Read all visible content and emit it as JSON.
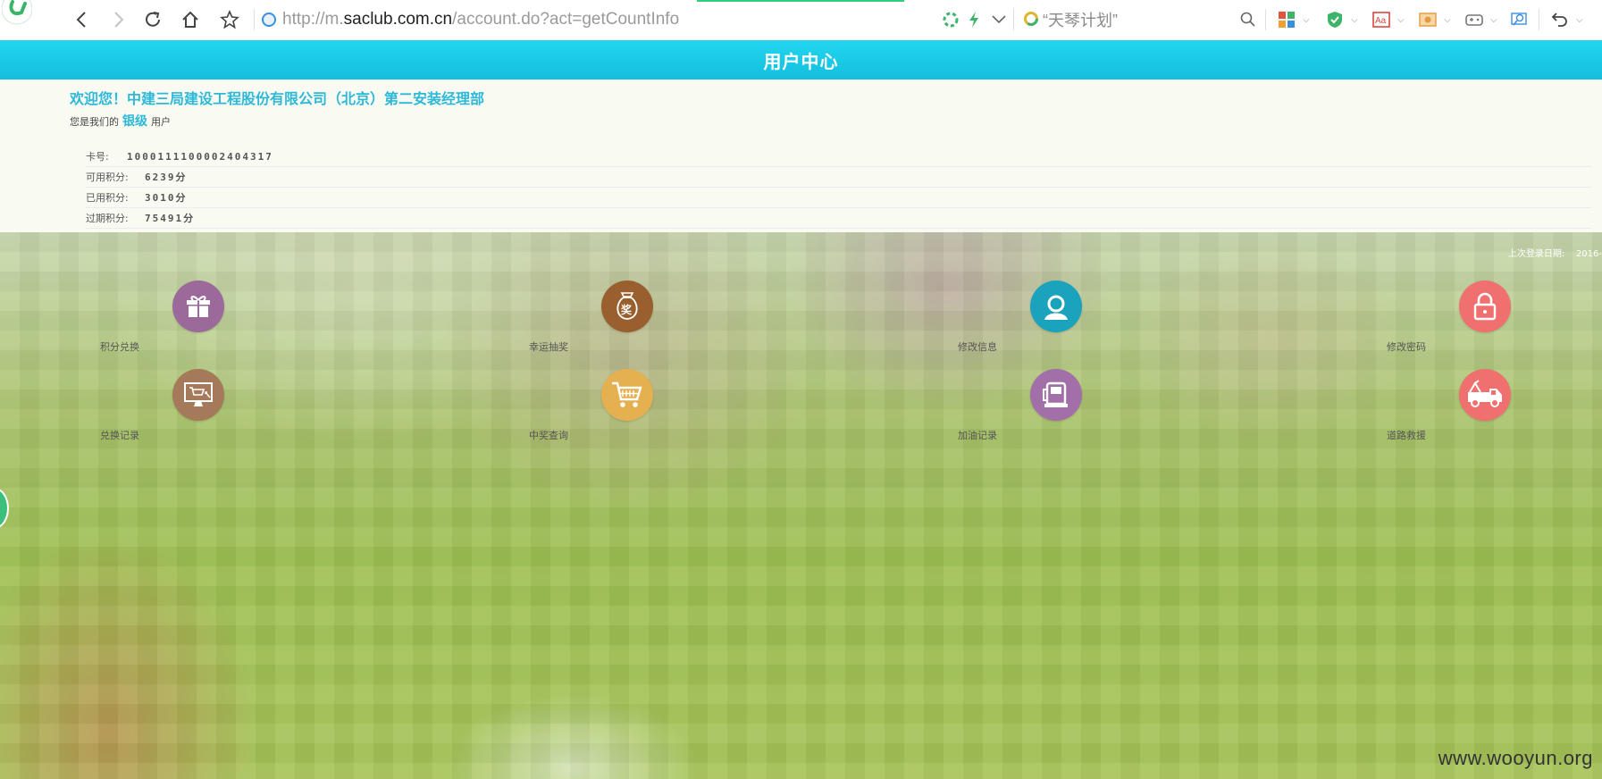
{
  "browser": {
    "url_prefix": "http://m.",
    "url_host": "saclub.com.cn",
    "url_path": "/account.do?act=getCountInfo",
    "search_text": "“天琴计划”"
  },
  "header": {
    "title": "用户中心"
  },
  "user": {
    "welcome": "欢迎您！中建三局建设工程股份有限公司（北京）第二安装经理部",
    "level_prefix": "您是我们的",
    "level": "银级",
    "level_suffix": "用户"
  },
  "info": [
    {
      "label": "卡号:",
      "value": "1000111100002404317"
    },
    {
      "label": "可用积分:",
      "value": "6239分"
    },
    {
      "label": "已用积分:",
      "value": "3010分"
    },
    {
      "label": "过期积分:",
      "value": "75491分"
    }
  ],
  "last_login": {
    "label": "上次登录日期:",
    "value": "2016-"
  },
  "menu": [
    {
      "label": "积分兑换",
      "icon": "gift-icon",
      "color": "#9b6a9b"
    },
    {
      "label": "幸运抽奖",
      "icon": "prize-bag-icon",
      "color": "#9a5f2f"
    },
    {
      "label": "修改信息",
      "icon": "user-profile-icon",
      "color": "#1ba3bd"
    },
    {
      "label": "修改密码",
      "icon": "lock-icon",
      "color": "#f07070"
    },
    {
      "label": "兑换记录",
      "icon": "monitor-cart-icon",
      "color": "#a57a5a"
    },
    {
      "label": "中奖查询",
      "icon": "shopping-cart-icon",
      "color": "#e5b050"
    },
    {
      "label": "加油记录",
      "icon": "fuel-pump-icon",
      "color": "#a36fa9"
    },
    {
      "label": "道路救援",
      "icon": "tow-truck-icon",
      "color": "#f07070"
    }
  ],
  "prize_glyph": "奖",
  "watermark": "www.wooyun.org"
}
